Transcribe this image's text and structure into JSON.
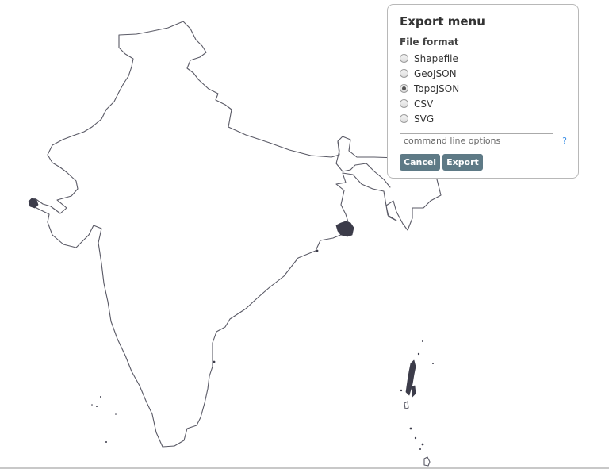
{
  "export_menu": {
    "title": "Export menu",
    "format_label": "File format",
    "formats": [
      {
        "label": "Shapefile",
        "selected": false
      },
      {
        "label": "GeoJSON",
        "selected": false
      },
      {
        "label": "TopoJSON",
        "selected": true
      },
      {
        "label": "CSV",
        "selected": false
      },
      {
        "label": "SVG",
        "selected": false
      }
    ],
    "options_input": {
      "value": "",
      "placeholder": "command line options"
    },
    "help_label": "?",
    "cancel_label": "Cancel",
    "export_label": "Export"
  },
  "map": {
    "stroke_color": "#5a5a66",
    "fill_color": "#3c3c4a"
  }
}
